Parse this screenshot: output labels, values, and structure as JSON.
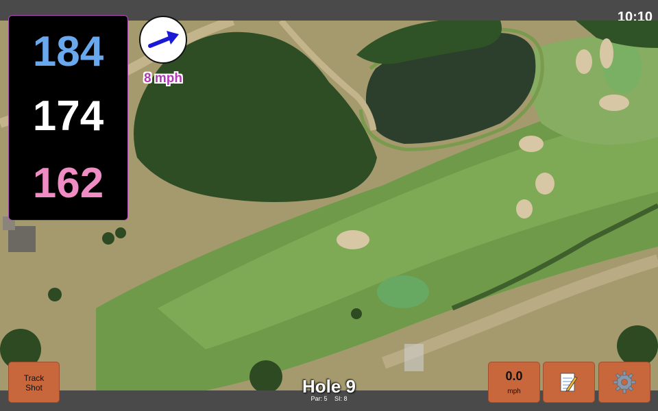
{
  "status": {
    "time": "10:10"
  },
  "distances": {
    "back": "184",
    "center": "174",
    "front": "162",
    "colors": {
      "back": "#6aa8ee",
      "center": "#ffffff",
      "front": "#f08cc4"
    }
  },
  "wind": {
    "speed_label": "8 mph",
    "direction_icon": "arrow-icon",
    "arrow_color": "#1a1ad6"
  },
  "buttons": {
    "track_shot_line1": "Track",
    "track_shot_line2": "Shot",
    "wind_value": "0.0",
    "wind_unit": "mph",
    "notes_icon": "notepad-pencil-icon",
    "settings_icon": "gear-icon"
  },
  "hole": {
    "title": "Hole 9",
    "par": "Par: 5",
    "si": "SI: 8"
  },
  "theme": {
    "accent": "#b04bb8",
    "button": "#c8663c",
    "bar": "#4a4a4a"
  }
}
